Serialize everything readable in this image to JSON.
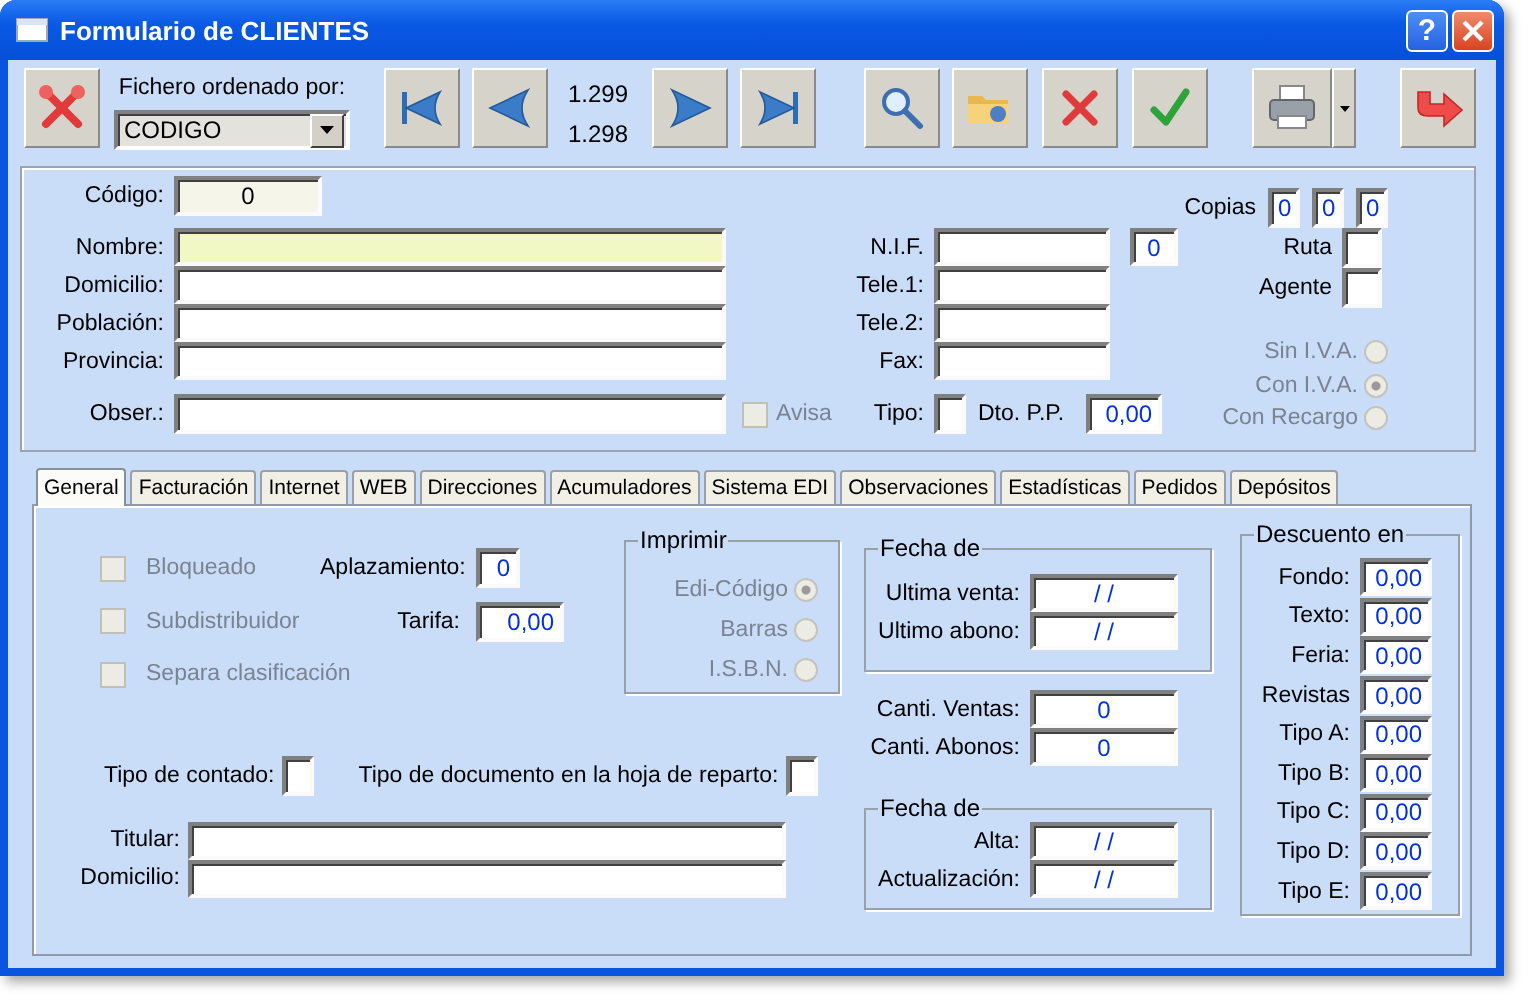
{
  "window": {
    "title": "Formulario de CLIENTES",
    "help_label": "?"
  },
  "toolbar": {
    "sort_label": "Fichero ordenado por:",
    "sort_value": "CODIGO",
    "counters": [
      "1.299",
      "1.298"
    ]
  },
  "header": {
    "codigo": {
      "label": "Código:",
      "value": "0",
      "readonly": true
    },
    "fields": [
      {
        "label": "Nombre:",
        "focused": true
      },
      {
        "label": "Domicilio:",
        "focused": false
      },
      {
        "label": "Población:",
        "focused": false
      },
      {
        "label": "Provincia:",
        "focused": false
      }
    ],
    "obser": {
      "label": "Obser.:"
    },
    "avisa": {
      "label": "Avisa",
      "checked": false,
      "disabled": true
    },
    "contact": [
      {
        "label": "N.I.F."
      },
      {
        "label": "Tele.1:"
      },
      {
        "label": "Tele.2:"
      },
      {
        "label": "Fax:"
      }
    ],
    "nif_extra": "0",
    "tipo": {
      "label": "Tipo:"
    },
    "dto": {
      "label": "Dto. P.P.",
      "value": "0,00"
    },
    "copias": {
      "label": "Copias",
      "values": [
        "0",
        "0",
        "0"
      ]
    },
    "ruta": {
      "label": "Ruta"
    },
    "agente": {
      "label": "Agente"
    },
    "iva": [
      {
        "label": "Sin I.V.A.",
        "selected": false,
        "disabled": true
      },
      {
        "label": "Con I.V.A.",
        "selected": true,
        "disabled": true
      },
      {
        "label": "Con Recargo",
        "selected": false,
        "disabled": true
      }
    ]
  },
  "tabs": [
    {
      "label": "General",
      "selected": true
    },
    {
      "label": "Facturación",
      "selected": false
    },
    {
      "label": "Internet",
      "selected": false
    },
    {
      "label": "WEB",
      "selected": false
    },
    {
      "label": "Direcciones",
      "selected": false
    },
    {
      "label": "Acumuladores",
      "selected": false
    },
    {
      "label": "Sistema EDI",
      "selected": false
    },
    {
      "label": "Observaciones",
      "selected": false
    },
    {
      "label": "Estadísticas",
      "selected": false
    },
    {
      "label": "Pedidos",
      "selected": false
    },
    {
      "label": "Depósitos",
      "selected": false
    }
  ],
  "general": {
    "checks": [
      {
        "label": "Bloqueado",
        "checked": false,
        "disabled": true
      },
      {
        "label": "Subdistribuidor",
        "checked": false,
        "disabled": true
      },
      {
        "label": "Separa clasificación",
        "checked": false,
        "disabled": true
      }
    ],
    "aplazamiento": {
      "label": "Aplazamiento:",
      "value": "0"
    },
    "tarifa": {
      "label": "Tarifa:",
      "value": "0,00"
    },
    "imprimir": {
      "title": "Imprimir",
      "options": [
        {
          "label": "Edi-Código",
          "selected": true,
          "disabled": true
        },
        {
          "label": "Barras",
          "selected": false,
          "disabled": true
        },
        {
          "label": "I.S.B.N.",
          "selected": false,
          "disabled": true
        }
      ]
    },
    "tipo_contado": {
      "label": "Tipo de contado:"
    },
    "tipo_documento": {
      "label": "Tipo de documento en la hoja de reparto:"
    },
    "titular": {
      "label": "Titular:"
    },
    "domicilio": {
      "label": "Domicilio:"
    },
    "fechas": {
      "title": "Fecha de",
      "fields": [
        {
          "label": "Ultima venta:",
          "value": "/ /"
        },
        {
          "label": "Ultimo abono:",
          "value": "/ /"
        }
      ]
    },
    "cantidades": [
      {
        "label": "Canti. Ventas:",
        "value": "0"
      },
      {
        "label": "Canti. Abonos:",
        "value": "0"
      }
    ],
    "fechas_alta": {
      "title": "Fecha de",
      "fields": [
        {
          "label": "Alta:",
          "value": "/ /"
        },
        {
          "label": "Actualización:",
          "value": "/ /"
        }
      ]
    },
    "descuento": {
      "title": "Descuento en",
      "fields": [
        {
          "label": "Fondo:",
          "value": "0,00"
        },
        {
          "label": "Texto:",
          "value": "0,00"
        },
        {
          "label": "Feria:",
          "value": "0,00"
        },
        {
          "label": "Revistas",
          "value": "0,00"
        },
        {
          "label": "Tipo A:",
          "value": "0,00"
        },
        {
          "label": "Tipo B:",
          "value": "0,00"
        },
        {
          "label": "Tipo C:",
          "value": "0,00"
        },
        {
          "label": "Tipo D:",
          "value": "0,00"
        },
        {
          "label": "Tipo E:",
          "value": "0,00"
        }
      ]
    }
  }
}
